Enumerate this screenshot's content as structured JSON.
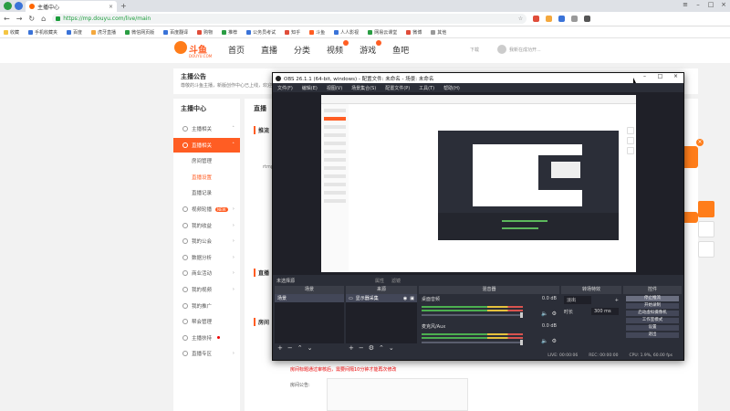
{
  "browser": {
    "tab_title": "主播中心",
    "url": "https://mp.douyu.com/live/main",
    "new_tab": "+",
    "bookmarks": [
      "收藏",
      "手机收藏夹",
      "百度",
      "虎牙直播",
      "微信网页版",
      "百度翻译",
      "购物",
      "推荐",
      "公务员考试",
      "知乎",
      "斗鱼",
      "人人影视",
      "网易云课堂",
      "微博",
      "其他"
    ]
  },
  "site": {
    "logo_text": "斗鱼",
    "logo_sub": "DOUYU.COM",
    "nav": [
      "首页",
      "直播",
      "分类",
      "视频",
      "游戏",
      "鱼吧"
    ],
    "download": "下载",
    "user_label": "我新在成功开..."
  },
  "notice": {
    "title": "主播公告",
    "text": "尊敬的斗鱼主播，新版创作中心已上线，欢迎体验"
  },
  "sidebar": {
    "title": "主播中心",
    "items": [
      {
        "label": "主播相关",
        "arrow": "˄"
      },
      {
        "label": "直播相关",
        "arrow": "˄"
      },
      {
        "label": "房间管理"
      },
      {
        "label": "直播设置"
      },
      {
        "label": "直播记录"
      },
      {
        "label": "视频轮播",
        "arrow": "›",
        "badge": "NEW"
      },
      {
        "label": "我的收益",
        "arrow": "›"
      },
      {
        "label": "我的公会",
        "arrow": "›"
      },
      {
        "label": "数据分析",
        "arrow": "›"
      },
      {
        "label": "商业活动",
        "arrow": "›"
      },
      {
        "label": "我的视频",
        "arrow": "›"
      },
      {
        "label": "我的推广"
      },
      {
        "label": "帮会管理"
      },
      {
        "label": "主播扶持"
      },
      {
        "label": "直播专区",
        "arrow": "›"
      }
    ]
  },
  "content": {
    "title": "直播",
    "section1": "推流",
    "section2": "直播",
    "section3": "房间",
    "label_small": "rtmp",
    "warning": "房间标题通过审核后，需要间隔10分钟才能再次修改",
    "announce_label": "房间公告:"
  },
  "obs": {
    "title": "OBS 26.1.1 (64-bit, windows) - 配置文件: 未命名 - 场景: 未命名",
    "menu": [
      "文件(F)",
      "编辑(E)",
      "视图(V)",
      "场景集合(S)",
      "配置文件(P)",
      "工具(T)",
      "帮助(H)"
    ],
    "source_bar": "未选择源",
    "source_props": "属性",
    "source_filters": "滤镜",
    "docks": {
      "scenes": "场景",
      "sources": "来源",
      "mixer": "混音器",
      "transitions": "转场特效",
      "controls": "控件"
    },
    "scene_item": "场景",
    "source_item": "显示器采集",
    "mixer_tracks": [
      {
        "name": "桌面音频",
        "db": "0.0 dB"
      },
      {
        "name": "麦克风/Aux",
        "db": "0.0 dB"
      }
    ],
    "transition": {
      "type": "淡出",
      "duration_label": "时长",
      "duration": "300 ms"
    },
    "controls": [
      "停止推流",
      "开始录制",
      "启动虚拟摄像机",
      "工作室模式",
      "设置",
      "退出"
    ],
    "status": {
      "live": "LIVE: 00:00:06",
      "rec": "REC: 00:00:00",
      "cpu": "CPU: 1.9%, 60.00 fps"
    }
  }
}
